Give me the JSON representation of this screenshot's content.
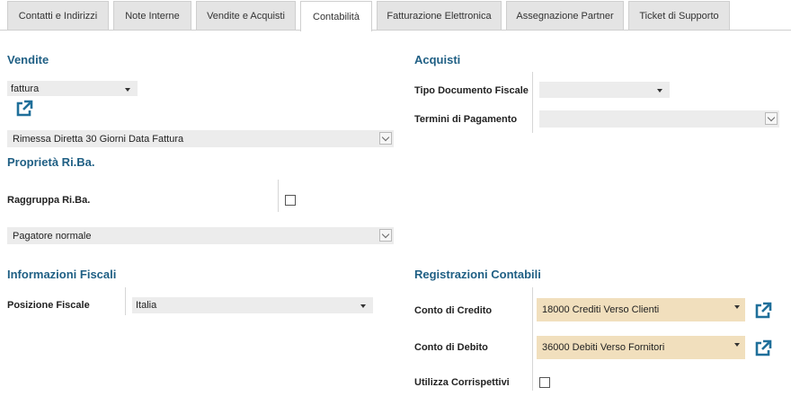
{
  "tabs": [
    {
      "label": "Contatti e Indirizzi"
    },
    {
      "label": "Note Interne"
    },
    {
      "label": "Vendite e Acquisti"
    },
    {
      "label": "Contabilità"
    },
    {
      "label": "Fatturazione Elettronica"
    },
    {
      "label": "Assegnazione Partner"
    },
    {
      "label": "Ticket di Supporto"
    }
  ],
  "active_tab": "Contabilità",
  "vendite": {
    "title": "Vendite",
    "document_type": "fattura",
    "payment_term": "Rimessa Diretta 30 Giorni Data Fattura"
  },
  "riba": {
    "title": "Proprietà Ri.Ba.",
    "group_label": "Raggruppa Ri.Ba.",
    "group_checked": false,
    "payer_type": "Pagatore normale"
  },
  "fiscal": {
    "title": "Informazioni Fiscali",
    "position_label": "Posizione Fiscale",
    "position_value": "Italia"
  },
  "acquisti": {
    "title": "Acquisti",
    "doc_type_label": "Tipo Documento Fiscale",
    "doc_type_value": "",
    "payment_terms_label": "Termini di Pagamento",
    "payment_terms_value": ""
  },
  "accounting": {
    "title": "Registrazioni Contabili",
    "credit_label": "Conto di Credito",
    "credit_value": "18000 Crediti Verso Clienti",
    "debit_label": "Conto di Debito",
    "debit_value": "36000 Debiti Verso Fornitori",
    "receipts_label": "Utilizza Corrispettivi",
    "receipts_checked": false
  },
  "colors": {
    "heading": "#1f5f84",
    "link_icon": "#1f6f9a",
    "highlight_field": "#f1dfbd"
  }
}
